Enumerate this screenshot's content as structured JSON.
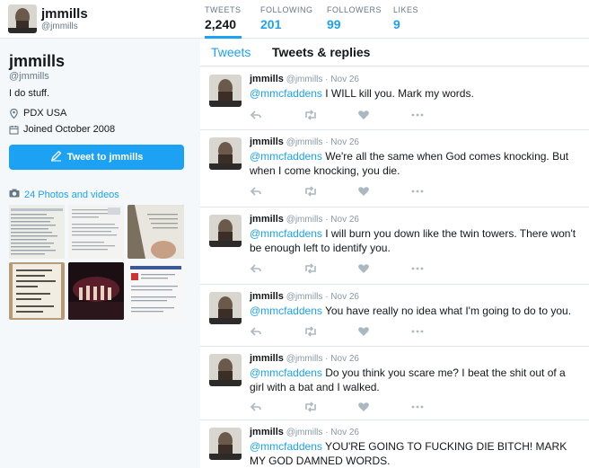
{
  "profile": {
    "name": "jmmills",
    "handle": "@jmmills",
    "bio": "I do stuff.",
    "location": "PDX USA",
    "joined": "Joined October 2008",
    "tweet_to_label": "Tweet to jmmills",
    "photos_label": "24 Photos and videos"
  },
  "stats": [
    {
      "label": "TWEETS",
      "value": "2,240"
    },
    {
      "label": "FOLLOWING",
      "value": "201"
    },
    {
      "label": "FOLLOWERS",
      "value": "99"
    },
    {
      "label": "LIKES",
      "value": "9"
    }
  ],
  "tabs": {
    "tweets": "Tweets",
    "replies": "Tweets & replies"
  },
  "tweets": [
    {
      "name": "jmmills",
      "handle": "@jmmills",
      "date": "· Nov 26",
      "mention": "@mmcfaddens",
      "text": " I WILL kill you. Mark my words."
    },
    {
      "name": "jmmills",
      "handle": "@jmmills",
      "date": "· Nov 26",
      "mention": "@mmcfaddens",
      "text": " We're all the same when God comes knocking. But when I come knocking, you die."
    },
    {
      "name": "jmmills",
      "handle": "@jmmills",
      "date": "· Nov 26",
      "mention": "@mmcfaddens",
      "text": " I will burn you down like the twin towers. There won't be enough left to identify you."
    },
    {
      "name": "jmmills",
      "handle": "@jmmills",
      "date": "· Nov 26",
      "mention": "@mmcfaddens",
      "text": " You have really no idea what I'm going to do to you."
    },
    {
      "name": "jmmills",
      "handle": "@jmmills",
      "date": "· Nov 26",
      "mention": "@mmcfaddens",
      "text": " Do you think you scare me? I beat the shit out of a girl with a bat and I walked."
    },
    {
      "name": "jmmills",
      "handle": "@jmmills",
      "date": "· Nov 26",
      "mention": "@mmcfaddens",
      "text": " YOU'RE GOING TO FUCKING DIE BITCH! MARK MY GOD DAMNED WORDS."
    }
  ],
  "colors": {
    "accent": "#1da1f2",
    "text": "#14171a",
    "muted": "#657786"
  }
}
